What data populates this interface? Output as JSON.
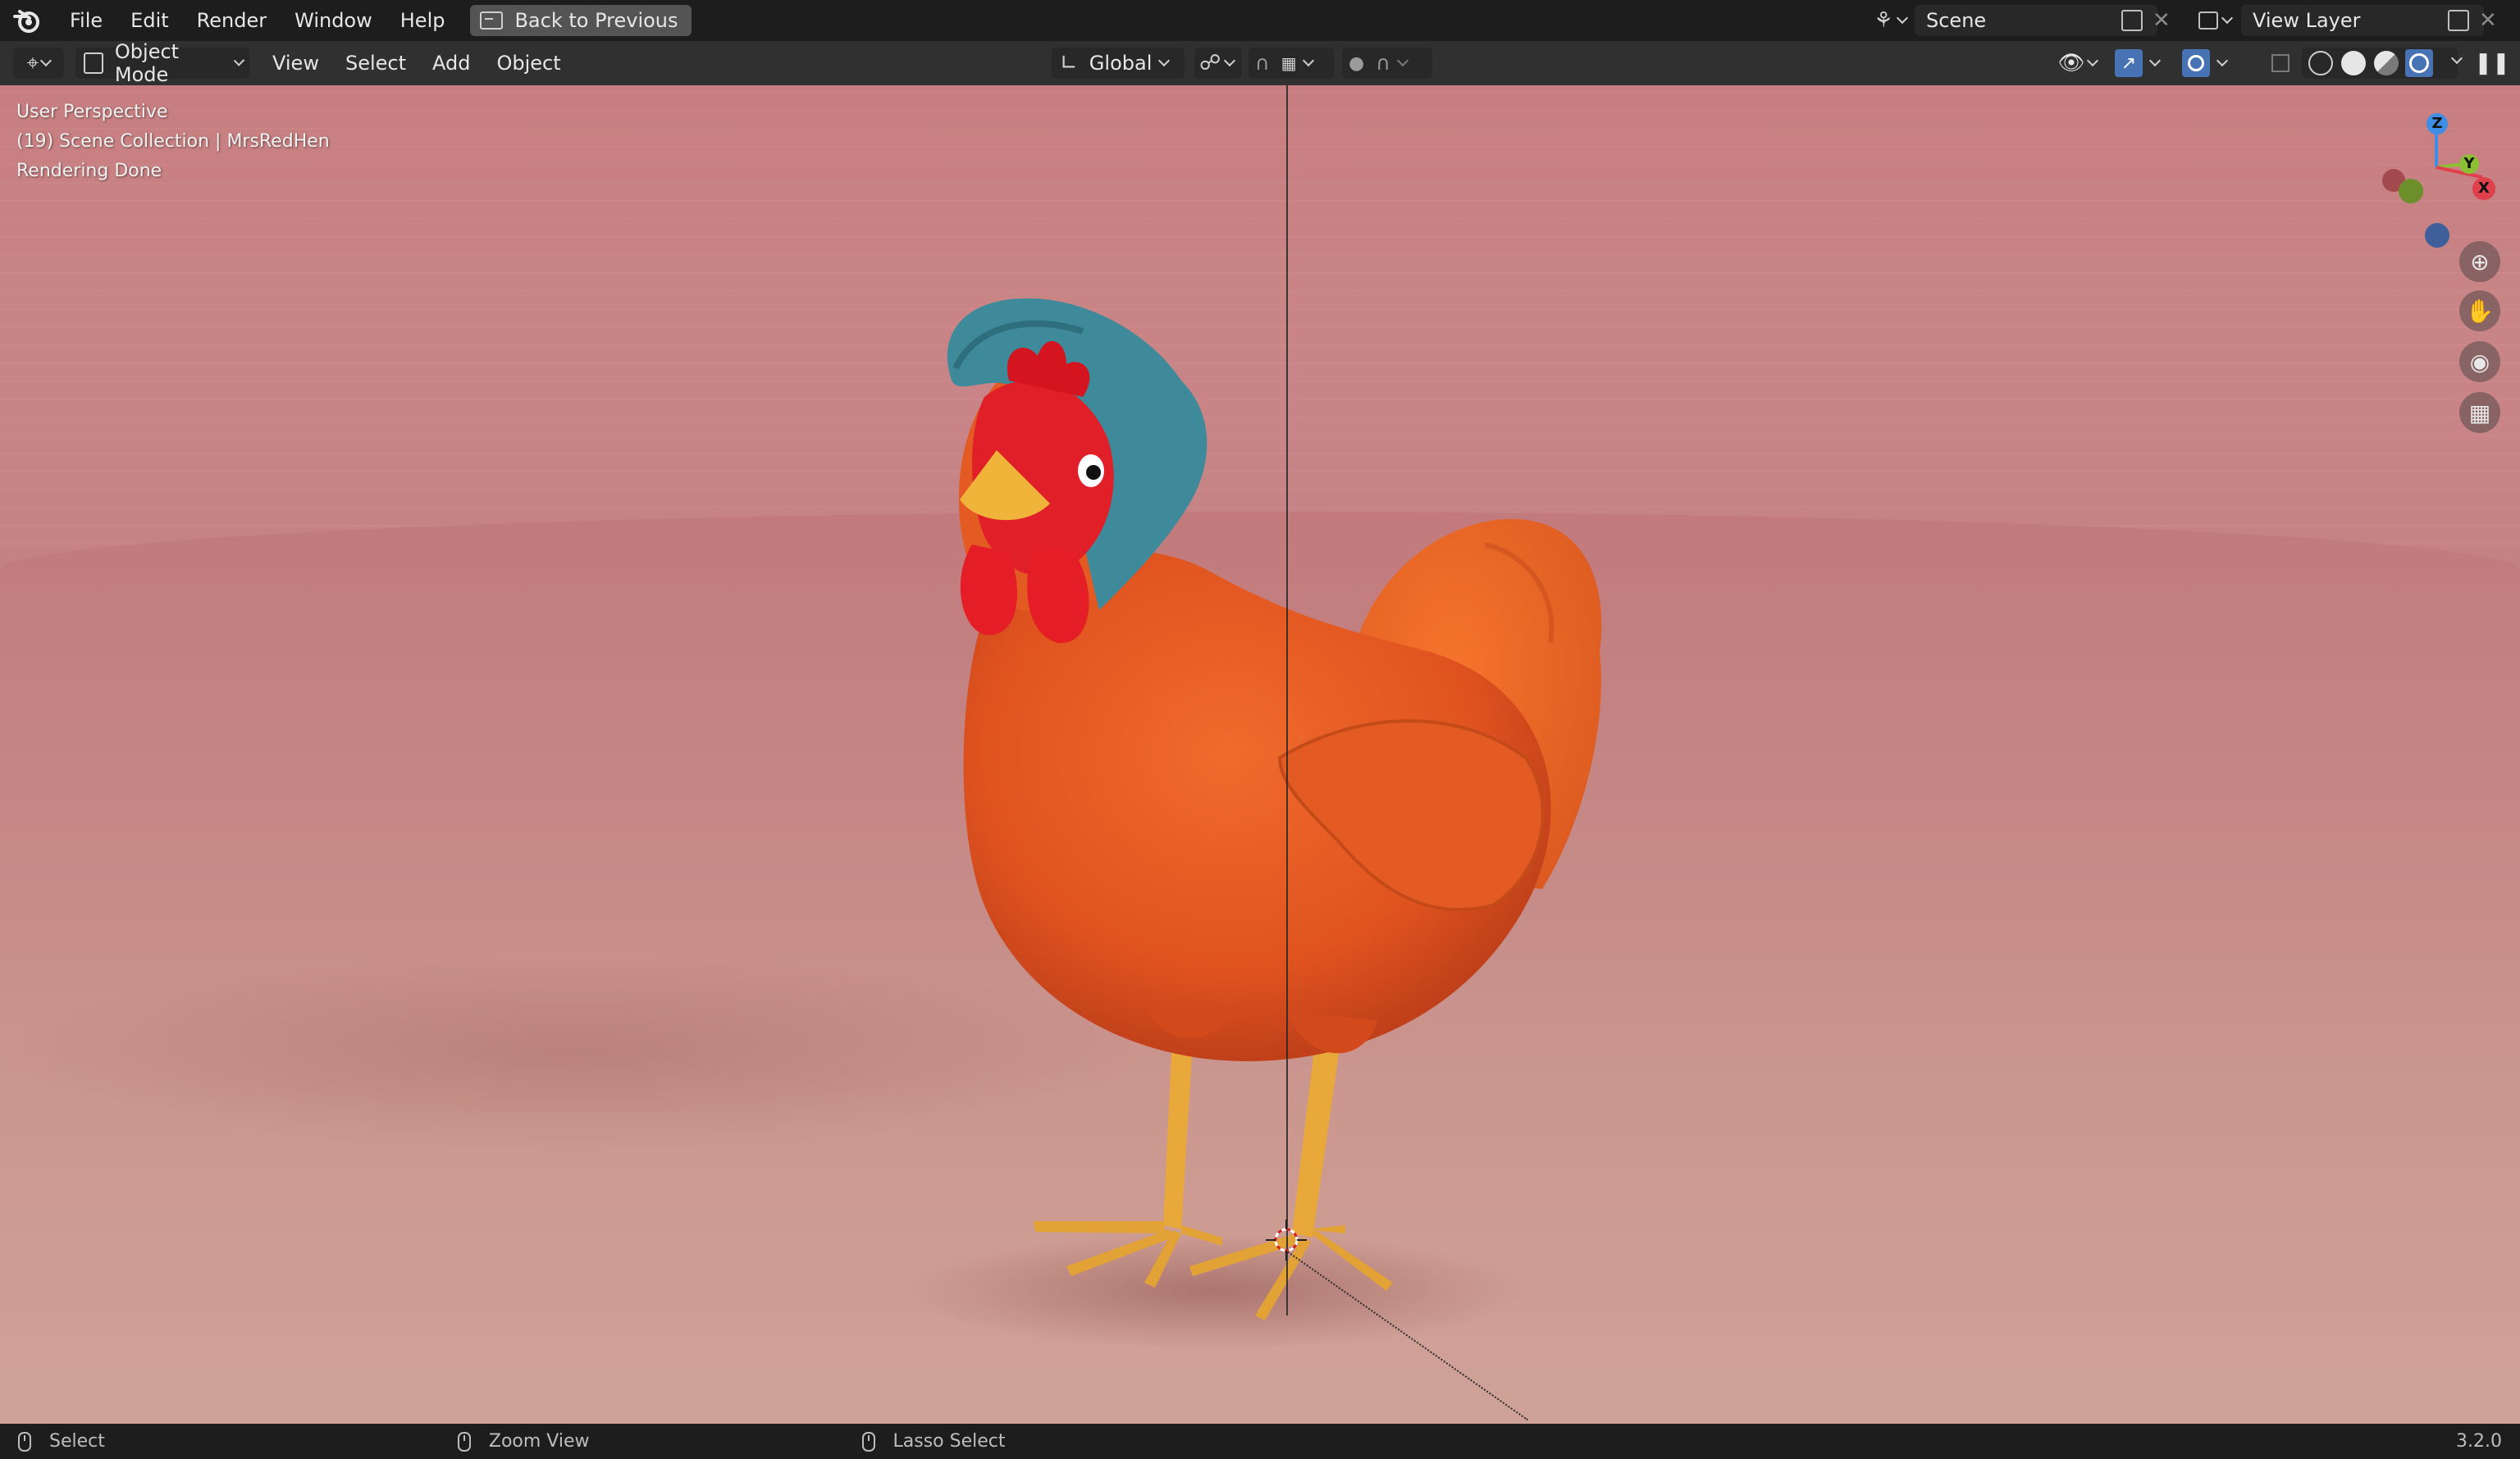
{
  "topbar": {
    "menu": [
      "File",
      "Edit",
      "Render",
      "Window",
      "Help"
    ],
    "back_button": "Back to Previous",
    "scene": "Scene",
    "view_layer": "View Layer"
  },
  "header": {
    "mode": "Object Mode",
    "menus": [
      "View",
      "Select",
      "Add",
      "Object"
    ],
    "orientation": "Global"
  },
  "viewport": {
    "line1": "User Perspective",
    "line2": "(19) Scene Collection | MrsRedHen",
    "line3": "Rendering Done",
    "gizmo": {
      "z": "Z",
      "y": "Y",
      "x": "X"
    }
  },
  "statusbar": {
    "select": "Select",
    "zoom": "Zoom View",
    "lasso": "Lasso Select",
    "version": "3.2.0"
  },
  "colors": {
    "accent": "#4772b3",
    "axis_x": "#e0404c",
    "axis_y": "#8bc034",
    "axis_z": "#3f8ee6"
  },
  "icons": [
    "blender-logo-icon",
    "back-icon",
    "scene-icon",
    "copy-icon",
    "close-icon",
    "view-layer-icon",
    "editor-type-icon",
    "object-mode-icon",
    "orientation-icon",
    "pivot-icon",
    "snap-icon",
    "proportional-icon",
    "visibility-icon",
    "gizmo-icon",
    "overlay-icon",
    "xray-icon",
    "wireframe-shading-icon",
    "solid-shading-icon",
    "material-shading-icon",
    "rendered-shading-icon",
    "zoom-icon",
    "pan-hand-icon",
    "camera-icon",
    "grid-icon",
    "mouse-icon"
  ]
}
